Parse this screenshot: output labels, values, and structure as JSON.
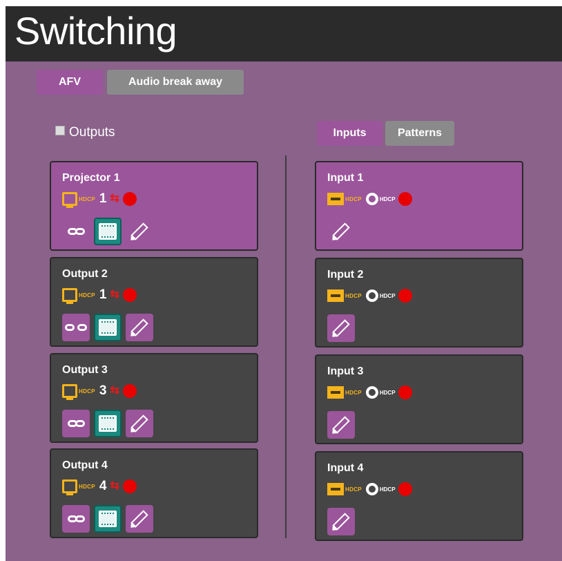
{
  "header": {
    "title": "Switching"
  },
  "mode_tabs": {
    "afv": "AFV",
    "audio_break_away": "Audio break away"
  },
  "outputs_toggle": {
    "label": "Outputs"
  },
  "list_tabs": {
    "inputs": "Inputs",
    "patterns": "Patterns"
  },
  "outputs": [
    {
      "name": "Projector 1",
      "hdcp": "HDCP",
      "port": "1",
      "selected": true
    },
    {
      "name": "Output 2",
      "hdcp": "HDCP",
      "port": "1",
      "selected": false
    },
    {
      "name": "Output 3",
      "hdcp": "HDCP",
      "port": "3",
      "selected": false
    },
    {
      "name": "Output 4",
      "hdcp": "HDCP",
      "port": "4",
      "selected": false
    }
  ],
  "inputs": [
    {
      "name": "Input 1",
      "hdcp": "HDCP",
      "hdcp2": "HDCP",
      "selected": true
    },
    {
      "name": "Input 2",
      "hdcp": "HDCP",
      "hdcp2": "HDCP",
      "selected": false
    },
    {
      "name": "Input 3",
      "hdcp": "HDCP",
      "hdcp2": "HDCP",
      "selected": false
    },
    {
      "name": "Input 4",
      "hdcp": "HDCP",
      "hdcp2": "HDCP",
      "selected": false
    }
  ],
  "colors": {
    "accent": "#9b559b",
    "background": "#8a628a",
    "card": "#454545",
    "status_red": "#e80000",
    "hdcp_yellow": "#f5b41c",
    "teal": "#1b8a80"
  },
  "icons": {
    "monitor": "monitor-icon",
    "port": "hdmi-port-icon",
    "swap": "swap-arrows-icon",
    "status": "status-dot-icon",
    "film": "film-reel-icon",
    "link": "link-icon",
    "unlink": "unlink-icon",
    "video": "video-frame-icon",
    "edit": "pencil-icon"
  }
}
